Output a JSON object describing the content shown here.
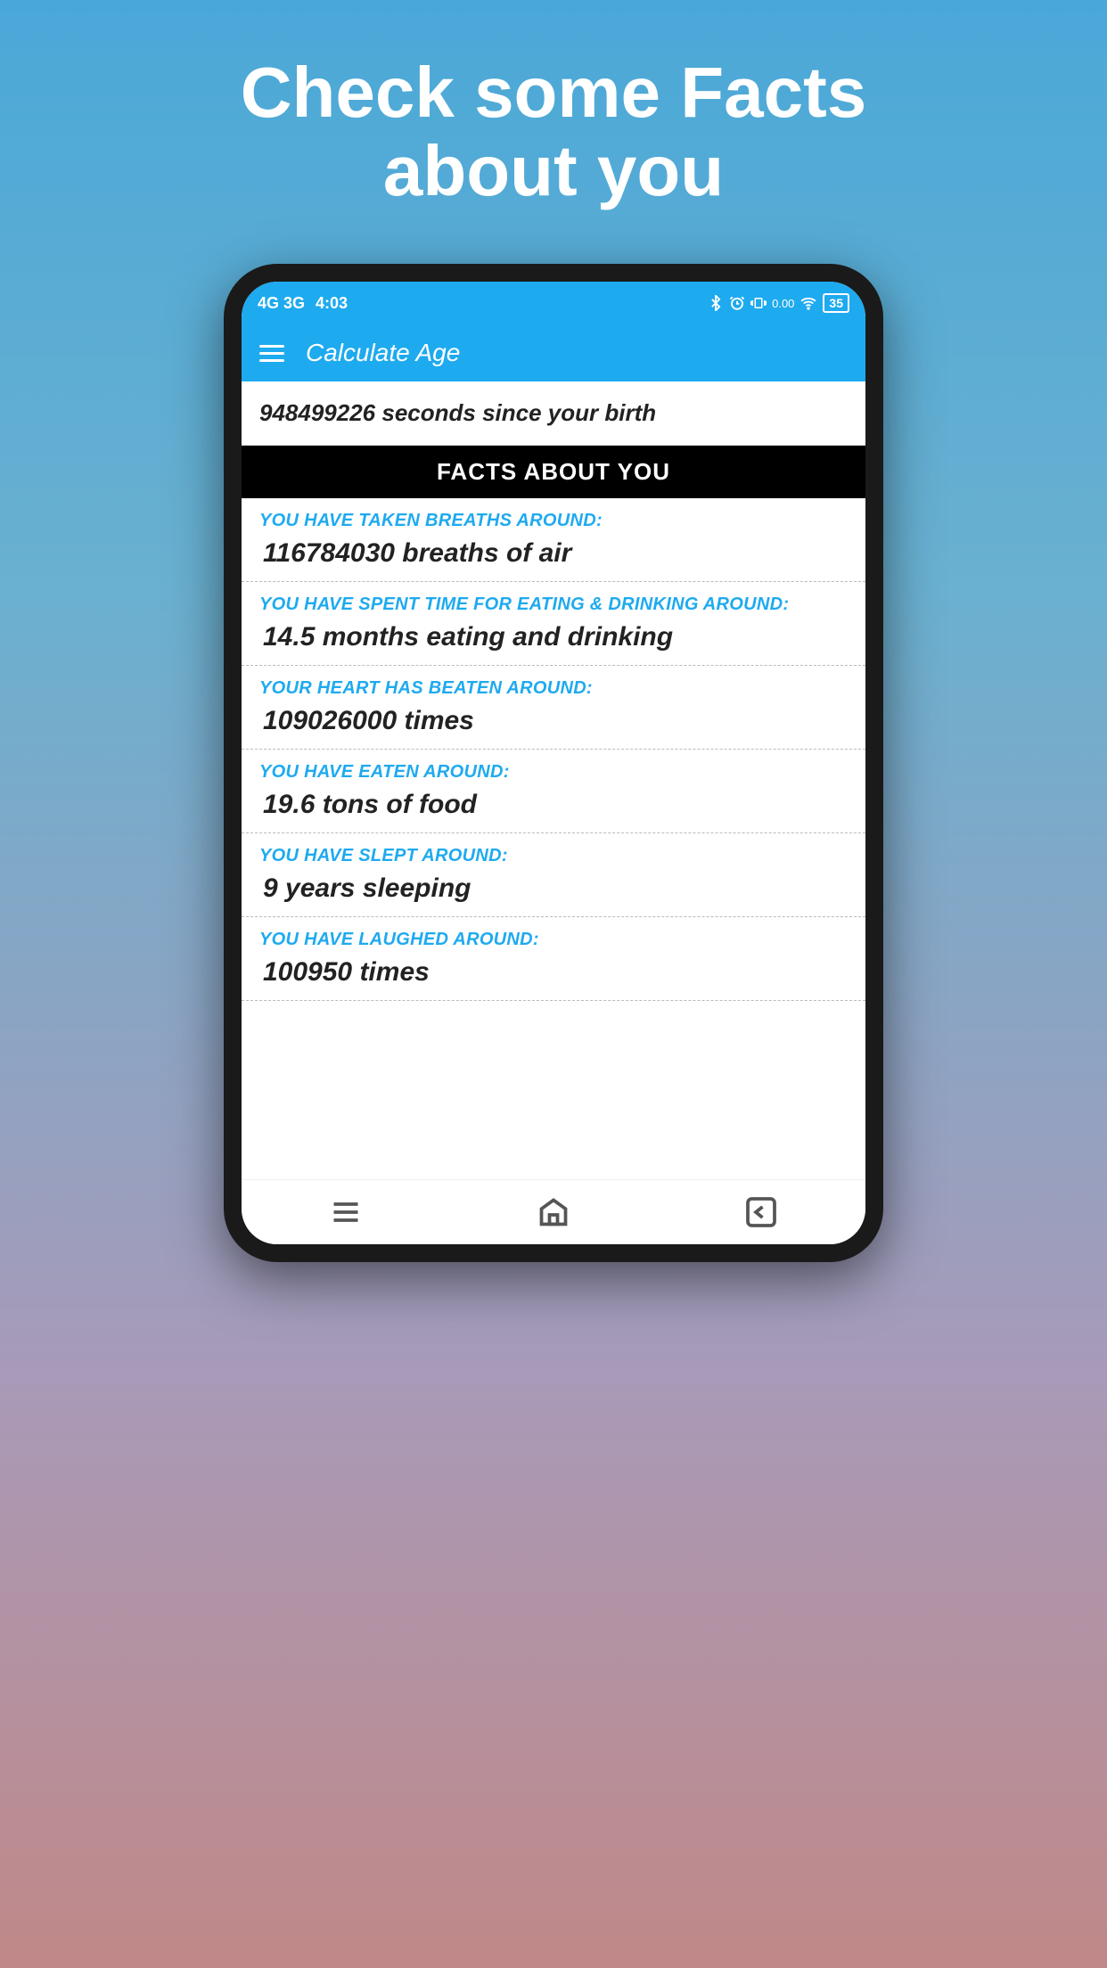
{
  "header": {
    "title": "Check some Facts\nabout you"
  },
  "status_bar": {
    "network": "4G 3G",
    "time": "4:03",
    "battery": "35"
  },
  "app_bar": {
    "title": "Calculate Age"
  },
  "seconds_row": {
    "text": "948499226 seconds since your birth"
  },
  "facts_header": {
    "text": "FACTS ABOUT YOU"
  },
  "facts": [
    {
      "label": "YOU HAVE TAKEN BREATHS AROUND:",
      "value": "116784030 breaths of air"
    },
    {
      "label": "YOU HAVE SPENT TIME FOR EATING & DRINKING AROUND:",
      "value": "14.5 months eating and drinking"
    },
    {
      "label": "YOUR HEART HAS BEATEN AROUND:",
      "value": "109026000 times"
    },
    {
      "label": "YOU HAVE EATEN AROUND:",
      "value": "19.6 tons of food"
    },
    {
      "label": "YOU HAVE SLEPT AROUND:",
      "value": "9 years sleeping"
    },
    {
      "label": "YOU HAVE LAUGHED AROUND:",
      "value": "100950 times"
    }
  ],
  "bottom_nav": {
    "items": [
      "menu",
      "home",
      "back"
    ]
  }
}
